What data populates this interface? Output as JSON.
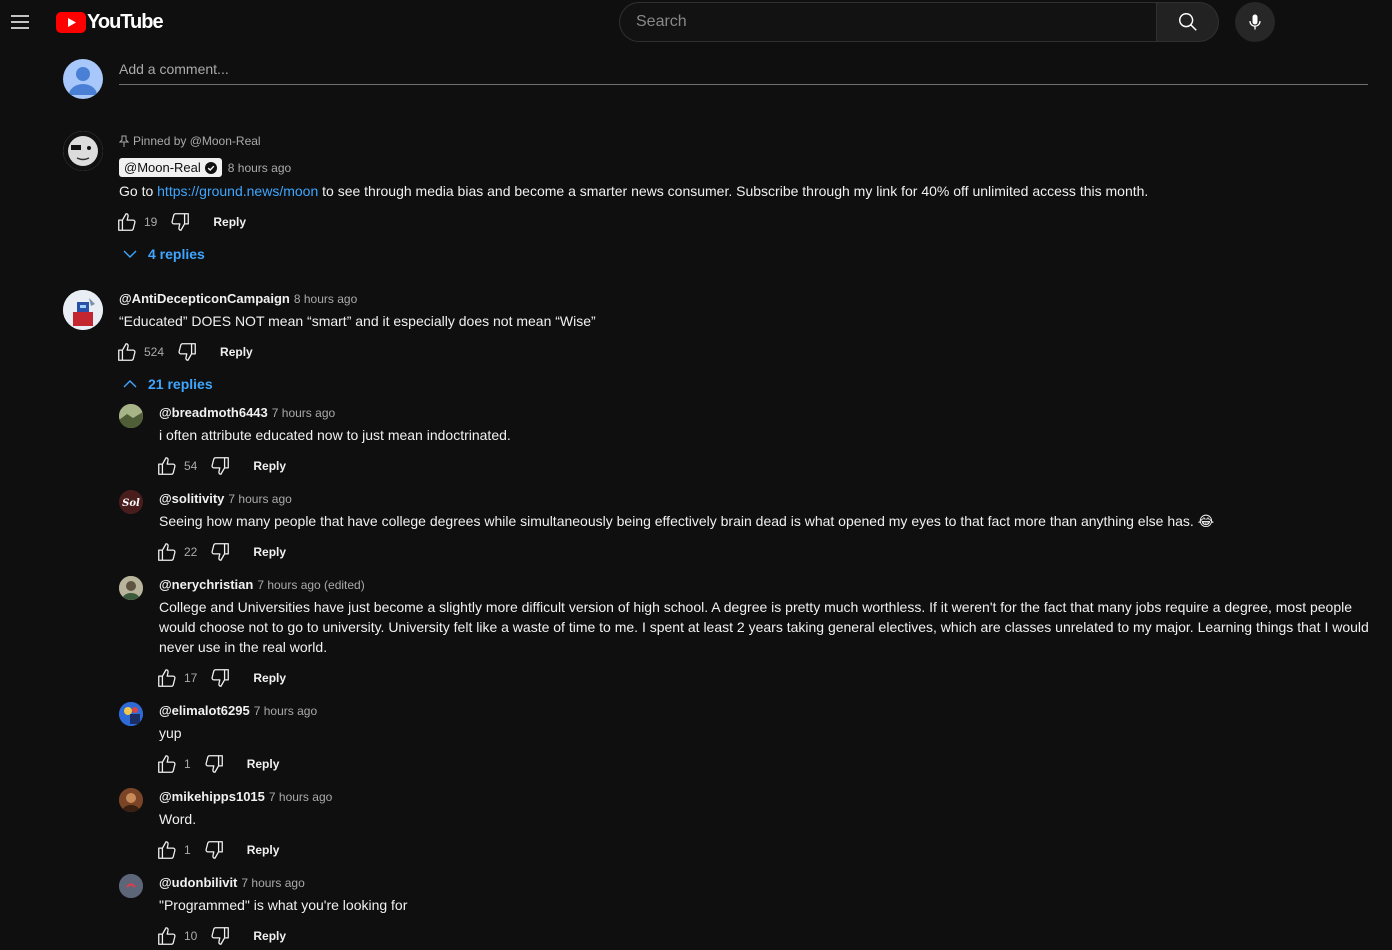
{
  "header": {
    "logo_text": "YouTube",
    "search_placeholder": "Search"
  },
  "add_comment": {
    "placeholder": "Add a comment..."
  },
  "pinned_comment": {
    "pinned_label": "Pinned by @Moon-Real",
    "author": "@Moon-Real",
    "time": "8 hours ago",
    "text_before_link": "Go to ",
    "link": "https://ground.news/moon",
    "text_after_link": " to see through media bias and become a smarter news consumer. Subscribe through my link for 40% off unlimited access this month.",
    "likes": "19",
    "reply_label": "Reply",
    "replies_toggle": "4 replies"
  },
  "comment": {
    "author": "@AntiDecepticonCampaign",
    "time": "8 hours ago",
    "text": "“Educated” DOES NOT mean “smart” and it especially does not mean “Wise”",
    "likes": "524",
    "reply_label": "Reply",
    "replies_toggle": "21 replies"
  },
  "replies": [
    {
      "author": "@breadmoth6443",
      "time": "7 hours ago",
      "text": "i often attribute educated now to just mean indoctrinated.",
      "likes": "54",
      "reply_label": "Reply"
    },
    {
      "author": "@solitivity",
      "time": "7 hours ago",
      "text": "Seeing how many people that have college degrees while simultaneously being effectively brain dead is what opened my eyes to that fact more than anything else has. 😂",
      "likes": "22",
      "reply_label": "Reply"
    },
    {
      "author": "@nerychristian",
      "time": "7 hours ago (edited)",
      "text": "College and Universities have just become a slightly more difficult version of high school. A degree is pretty much worthless. If it weren't for the fact that many jobs require a degree, most people would choose not to go to university. University felt like a waste of time to me. I spent at least 2 years taking general electives, which are classes unrelated to my major. Learning things that I would never use in the real world.",
      "likes": "17",
      "reply_label": "Reply"
    },
    {
      "author": "@elimalot6295",
      "time": "7 hours ago",
      "text": "yup",
      "likes": "1",
      "reply_label": "Reply"
    },
    {
      "author": "@mikehipps1015",
      "time": "7 hours ago",
      "text": "Word.",
      "likes": "1",
      "reply_label": "Reply"
    },
    {
      "author": "@udonbilivit",
      "time": "7 hours ago",
      "text": "\"Programmed\" is what you're looking for",
      "likes": "10",
      "reply_label": "Reply"
    }
  ],
  "icons": {
    "menu": "hamburger-menu-icon",
    "search": "search-icon",
    "mic": "microphone-icon",
    "like": "thumbs-up-icon",
    "dislike": "thumbs-down-icon",
    "pin": "pin-icon",
    "verified": "verified-check-icon",
    "expand": "chevron-down-icon",
    "collapse": "chevron-up-icon"
  },
  "colors": {
    "background": "#0f0f0f",
    "link": "#3ea6ff",
    "brand_red": "#ff0000",
    "secondary_text": "#aaaaaa"
  }
}
